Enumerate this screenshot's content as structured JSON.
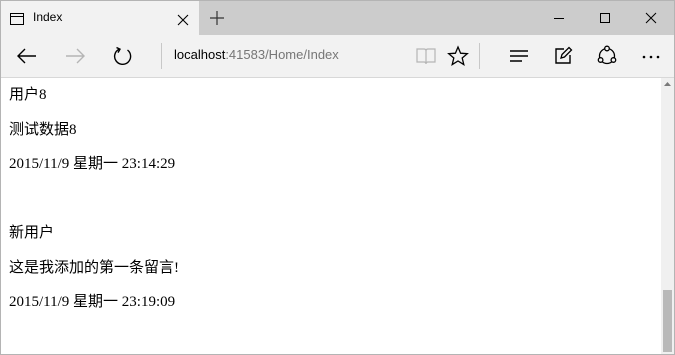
{
  "tab": {
    "title": "Index"
  },
  "address": {
    "host": "localhost",
    "path": ":41583/Home/Index"
  },
  "posts": [
    {
      "name": "用户8",
      "message": "测试数据8",
      "time": "2015/11/9 星期一 23:14:29"
    },
    {
      "name": "新用户",
      "message": "这是我添加的第一条留言!",
      "time": "2015/11/9 星期一 23:19:09"
    }
  ],
  "icons": {
    "tab": "page-icon",
    "close": "close-icon",
    "new_tab": "plus-icon",
    "minimize": "minimize-icon",
    "maximize": "maximize-icon",
    "window_close": "close-icon",
    "back": "back-arrow-icon",
    "forward": "forward-arrow-icon",
    "refresh": "refresh-icon",
    "reading_view": "book-icon",
    "favorite": "star-icon",
    "hub": "hub-icon",
    "note": "pen-icon",
    "share": "share-icon",
    "more": "more-icon"
  },
  "colors": {
    "tabbar": "#cccccc",
    "toolbar": "#f2f2f2",
    "disabled_icon": "#b5b5b5",
    "scroll_thumb": "#b9b9b9"
  }
}
